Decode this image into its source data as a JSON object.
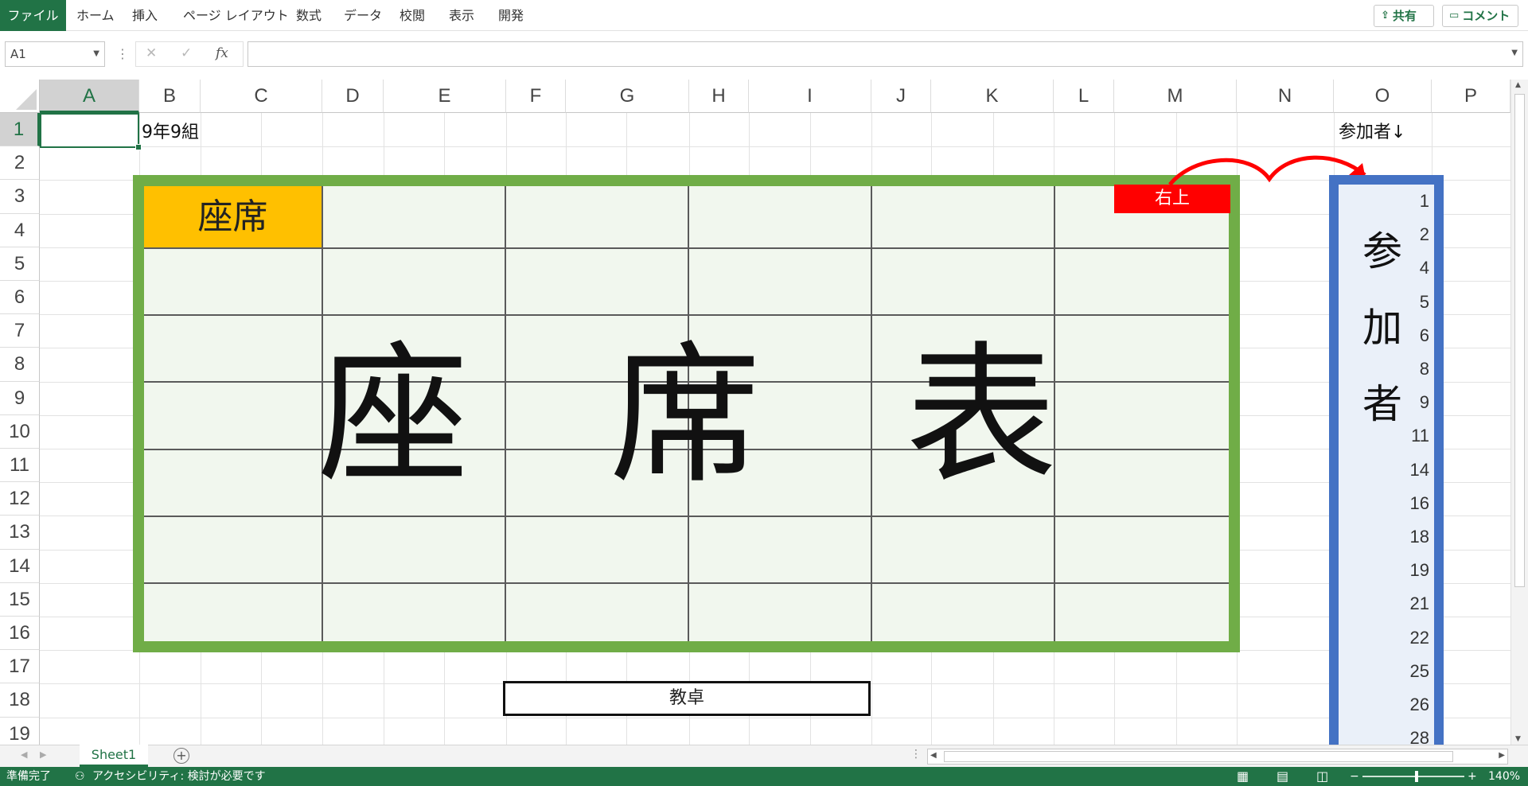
{
  "ribbon": {
    "tabs": [
      "ファイル",
      "ホーム",
      "挿入",
      "ページ レイアウト",
      "数式",
      "データ",
      "校閲",
      "表示",
      "開発"
    ],
    "share_label": "共有",
    "comment_label": "コメント"
  },
  "formula_bar": {
    "name_box": "A1",
    "cancel_icon": "✕",
    "enter_icon": "✓",
    "fx_label": "fx",
    "formula": ""
  },
  "sheet": {
    "columns": [
      "A",
      "B",
      "C",
      "D",
      "E",
      "F",
      "G",
      "H",
      "I",
      "J",
      "K",
      "L",
      "M",
      "N",
      "O",
      "P"
    ],
    "rows": [
      "1",
      "2",
      "3",
      "4",
      "5",
      "6",
      "7",
      "8",
      "9",
      "10",
      "11",
      "12",
      "13",
      "14",
      "15",
      "16",
      "17",
      "18",
      "19"
    ],
    "selected_cell": "A1",
    "b1": "9年9組",
    "o1": "参加者↓"
  },
  "seat_chart": {
    "label": "座席",
    "title_chars": [
      "座",
      "席",
      "表"
    ],
    "top_right_label": "右上",
    "podium_label": "教卓"
  },
  "participants": {
    "title_chars": [
      "参",
      "加",
      "者"
    ],
    "numbers": [
      "1",
      "2",
      "4",
      "5",
      "6",
      "8",
      "9",
      "11",
      "14",
      "16",
      "18",
      "19",
      "21",
      "22",
      "25",
      "26",
      "28"
    ]
  },
  "sheet_tabs": {
    "active": "Sheet1",
    "add_label": "+"
  },
  "status_bar": {
    "ready": "準備完了",
    "accessibility": "アクセシビリティ: 検討が必要です",
    "zoom": "140%",
    "zoom_minus": "−",
    "zoom_plus": "+"
  },
  "colors": {
    "excel_green": "#217346",
    "chart_border": "#70ad47",
    "seat_label_bg": "#ffc000",
    "top_right_bg": "#ff0000",
    "participants_border": "#4472c4",
    "arrow": "#ff0000"
  }
}
